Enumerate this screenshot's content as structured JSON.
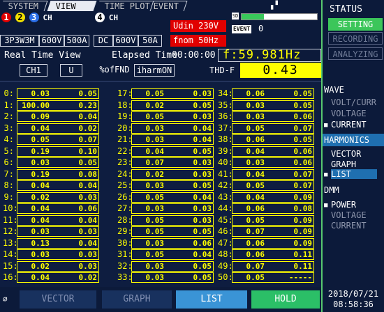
{
  "tabs": [
    {
      "label": "SYSTEM",
      "active": false
    },
    {
      "label": "VIEW",
      "active": true
    },
    {
      "label": "TIME PLOT",
      "active": false
    },
    {
      "label": "EVENT",
      "active": false
    }
  ],
  "channels": {
    "group1_numbers": [
      "1",
      "2",
      "3"
    ],
    "group1_suffix": "CH",
    "group1_wiring": "3P3W3M",
    "group1_voltage": "600V",
    "group1_current": "500A",
    "group2_number": "4",
    "group2_suffix": "CH",
    "group2_mode": "DC",
    "group2_voltage": "600V",
    "group2_current": "50A"
  },
  "udin": "Udin 230V",
  "fnom": "fnom  50Hz",
  "sd_label": "SD",
  "event_label": "EVENT",
  "event_count": "0",
  "storage_fill": 0.3,
  "view_title": "Real Time View",
  "elapsed_label": "Elapsed Time",
  "elapsed_value": "00:00:00",
  "frequency": "f:59.981Hz",
  "selectors": {
    "channel": "CH1",
    "quantity": "U",
    "unit": "%ofFND",
    "harm": "iharmON"
  },
  "thd_label": "THD-F",
  "thd_value": "0.43",
  "harmonics": [
    [
      "0",
      "0.03",
      "0.05"
    ],
    [
      "1",
      "100.00",
      "0.23"
    ],
    [
      "2",
      "0.09",
      "0.04"
    ],
    [
      "3",
      "0.04",
      "0.02"
    ],
    [
      "4",
      "0.05",
      "0.07"
    ],
    [
      "5",
      "0.19",
      "0.10"
    ],
    [
      "6",
      "0.03",
      "0.05"
    ],
    [
      "7",
      "0.19",
      "0.08"
    ],
    [
      "8",
      "0.04",
      "0.04"
    ],
    [
      "9",
      "0.02",
      "0.03"
    ],
    [
      "10",
      "0.04",
      "0.06"
    ],
    [
      "11",
      "0.04",
      "0.04"
    ],
    [
      "12",
      "0.03",
      "0.03"
    ],
    [
      "13",
      "0.13",
      "0.04"
    ],
    [
      "14",
      "0.03",
      "0.03"
    ],
    [
      "15",
      "0.02",
      "0.03"
    ],
    [
      "16",
      "0.04",
      "0.02"
    ],
    [
      "17",
      "0.05",
      "0.03"
    ],
    [
      "18",
      "0.02",
      "0.05"
    ],
    [
      "19",
      "0.05",
      "0.03"
    ],
    [
      "20",
      "0.03",
      "0.04"
    ],
    [
      "21",
      "0.03",
      "0.04"
    ],
    [
      "22",
      "0.04",
      "0.05"
    ],
    [
      "23",
      "0.07",
      "0.03"
    ],
    [
      "24",
      "0.02",
      "0.03"
    ],
    [
      "25",
      "0.03",
      "0.05"
    ],
    [
      "26",
      "0.05",
      "0.04"
    ],
    [
      "27",
      "0.03",
      "0.03"
    ],
    [
      "28",
      "0.05",
      "0.03"
    ],
    [
      "29",
      "0.05",
      "0.05"
    ],
    [
      "30",
      "0.03",
      "0.06"
    ],
    [
      "31",
      "0.05",
      "0.04"
    ],
    [
      "32",
      "0.03",
      "0.05"
    ],
    [
      "33",
      "0.03",
      "0.05"
    ],
    [
      "34",
      "0.06",
      "0.05"
    ],
    [
      "35",
      "0.03",
      "0.05"
    ],
    [
      "36",
      "0.03",
      "0.06"
    ],
    [
      "37",
      "0.05",
      "0.07"
    ],
    [
      "38",
      "0.06",
      "0.05"
    ],
    [
      "39",
      "0.04",
      "0.06"
    ],
    [
      "40",
      "0.03",
      "0.06"
    ],
    [
      "41",
      "0.04",
      "0.07"
    ],
    [
      "42",
      "0.05",
      "0.07"
    ],
    [
      "43",
      "0.04",
      "0.09"
    ],
    [
      "44",
      "0.06",
      "0.08"
    ],
    [
      "45",
      "0.05",
      "0.09"
    ],
    [
      "46",
      "0.07",
      "0.09"
    ],
    [
      "47",
      "0.06",
      "0.09"
    ],
    [
      "48",
      "0.06",
      "0.11"
    ],
    [
      "49",
      "0.07",
      "0.11"
    ],
    [
      "50",
      "0.05",
      "-----"
    ]
  ],
  "bottom_buttons": [
    "VECTOR",
    "GRAPH",
    "LIST",
    "HOLD"
  ],
  "status": {
    "header": "STATUS",
    "setting": "SETTING",
    "recording": "RECORDING",
    "analyzing": "ANALYZING",
    "wave_header": "WAVE",
    "wave_items": [
      "VOLT/CURR",
      "VOLTAGE",
      "CURRENT"
    ],
    "harmonics_header": "HARMONICS",
    "harm_items": [
      "VECTOR",
      "GRAPH",
      "LIST"
    ],
    "dmm_header": "DMM",
    "dmm_items": [
      "POWER",
      "VOLTAGE",
      "CURRENT"
    ]
  },
  "date": "2018/07/21",
  "time": "08:58:36",
  "colors": {
    "accent_green": "#3cc65a",
    "value_yellow": "#ffff00",
    "alert_red": "#e10000",
    "list_blue": "#3a94d6"
  }
}
